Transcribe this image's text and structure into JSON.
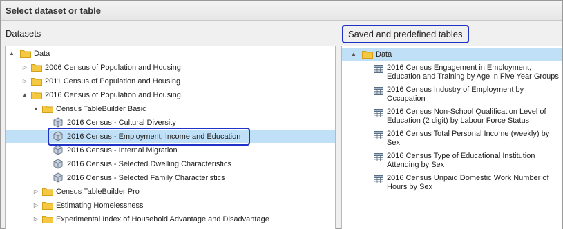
{
  "window": {
    "title": "Select dataset or table"
  },
  "datasets": {
    "header": "Datasets",
    "tree": [
      {
        "label": "Data",
        "type": "folder",
        "expander": "▲"
      },
      {
        "label": "2006 Census of Population and Housing",
        "type": "folder",
        "expander": "▷"
      },
      {
        "label": "2011 Census of Population and Housing",
        "type": "folder",
        "expander": "▷"
      },
      {
        "label": "2016 Census of Population and Housing",
        "type": "folder",
        "expander": "▲"
      },
      {
        "label": "Census TableBuilder Basic",
        "type": "folder",
        "expander": "▲"
      },
      {
        "label": "2016 Census - Cultural Diversity",
        "type": "dataset"
      },
      {
        "label": "2016 Census - Employment, Income and Education",
        "type": "dataset",
        "selected": true
      },
      {
        "label": "2016 Census - Internal Migration",
        "type": "dataset"
      },
      {
        "label": "2016 Census - Selected Dwelling Characteristics",
        "type": "dataset"
      },
      {
        "label": "2016 Census - Selected Family Characteristics",
        "type": "dataset"
      },
      {
        "label": "Census TableBuilder Pro",
        "type": "folder",
        "expander": "▷"
      },
      {
        "label": "Estimating Homelessness",
        "type": "folder",
        "expander": "▷"
      },
      {
        "label": "Experimental Index of Household Advantage and Disadvantage",
        "type": "folder",
        "expander": "▷"
      }
    ]
  },
  "saved": {
    "header": "Saved and predefined tables",
    "root": {
      "label": "Data",
      "expander": "▲"
    },
    "tables": [
      "2016 Census Engagement in Employment, Education and Training by Age in Five Year Groups",
      "2016 Census Industry of Employment by Occupation",
      "2016 Census Non-School Qualification Level of Education (2 digit) by Labour Force Status",
      "2016 Census Total Personal Income (weekly) by Sex",
      "2016 Census Type of Educational Institution Attending by Sex",
      "2016 Census Unpaid Domestic Work Number of Hours by Sex"
    ]
  },
  "colors": {
    "highlight": "#1f32c8",
    "selection": "#bfe0f7",
    "folder": "#f5c842"
  }
}
